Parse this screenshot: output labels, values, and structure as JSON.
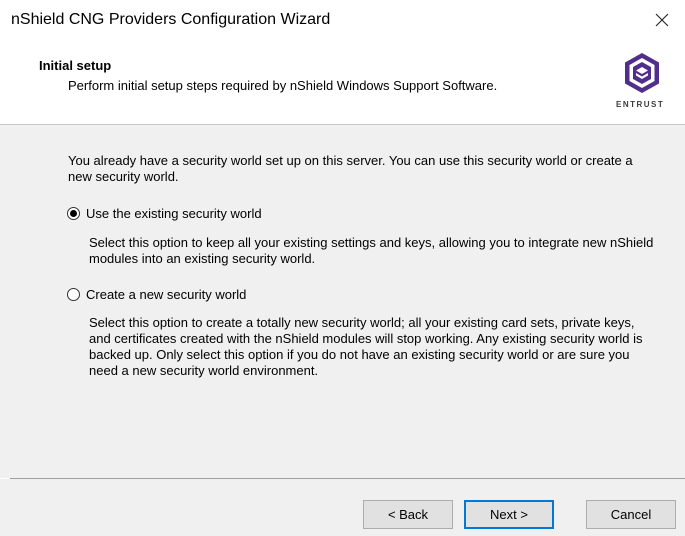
{
  "window": {
    "title": "nShield CNG Providers Configuration Wizard",
    "close_glyph": "✕"
  },
  "header": {
    "title": "Initial setup",
    "subtitle": "Perform initial setup steps required by nShield Windows Support Software.",
    "logo_text": "ENTRUST",
    "logo_color": "#512D8C"
  },
  "content": {
    "intro": "You already have a security world set up on this server. You can use this security world or create a new security world.",
    "options": [
      {
        "label": "Use the existing security world",
        "selected": true,
        "description": "Select this option to keep all your existing settings and keys, allowing you to integrate new nShield modules into an existing security world."
      },
      {
        "label": "Create a new security world",
        "selected": false,
        "description": "Select this option to create a totally new security world; all your existing card sets, private keys, and certificates created with the nShield modules will stop working. Any existing security world is backed up. Only select this option if you do not have an existing security world or are sure you need a new security world environment."
      }
    ]
  },
  "footer": {
    "back_label": "< Back",
    "next_label": "Next >",
    "cancel_label": "Cancel"
  }
}
